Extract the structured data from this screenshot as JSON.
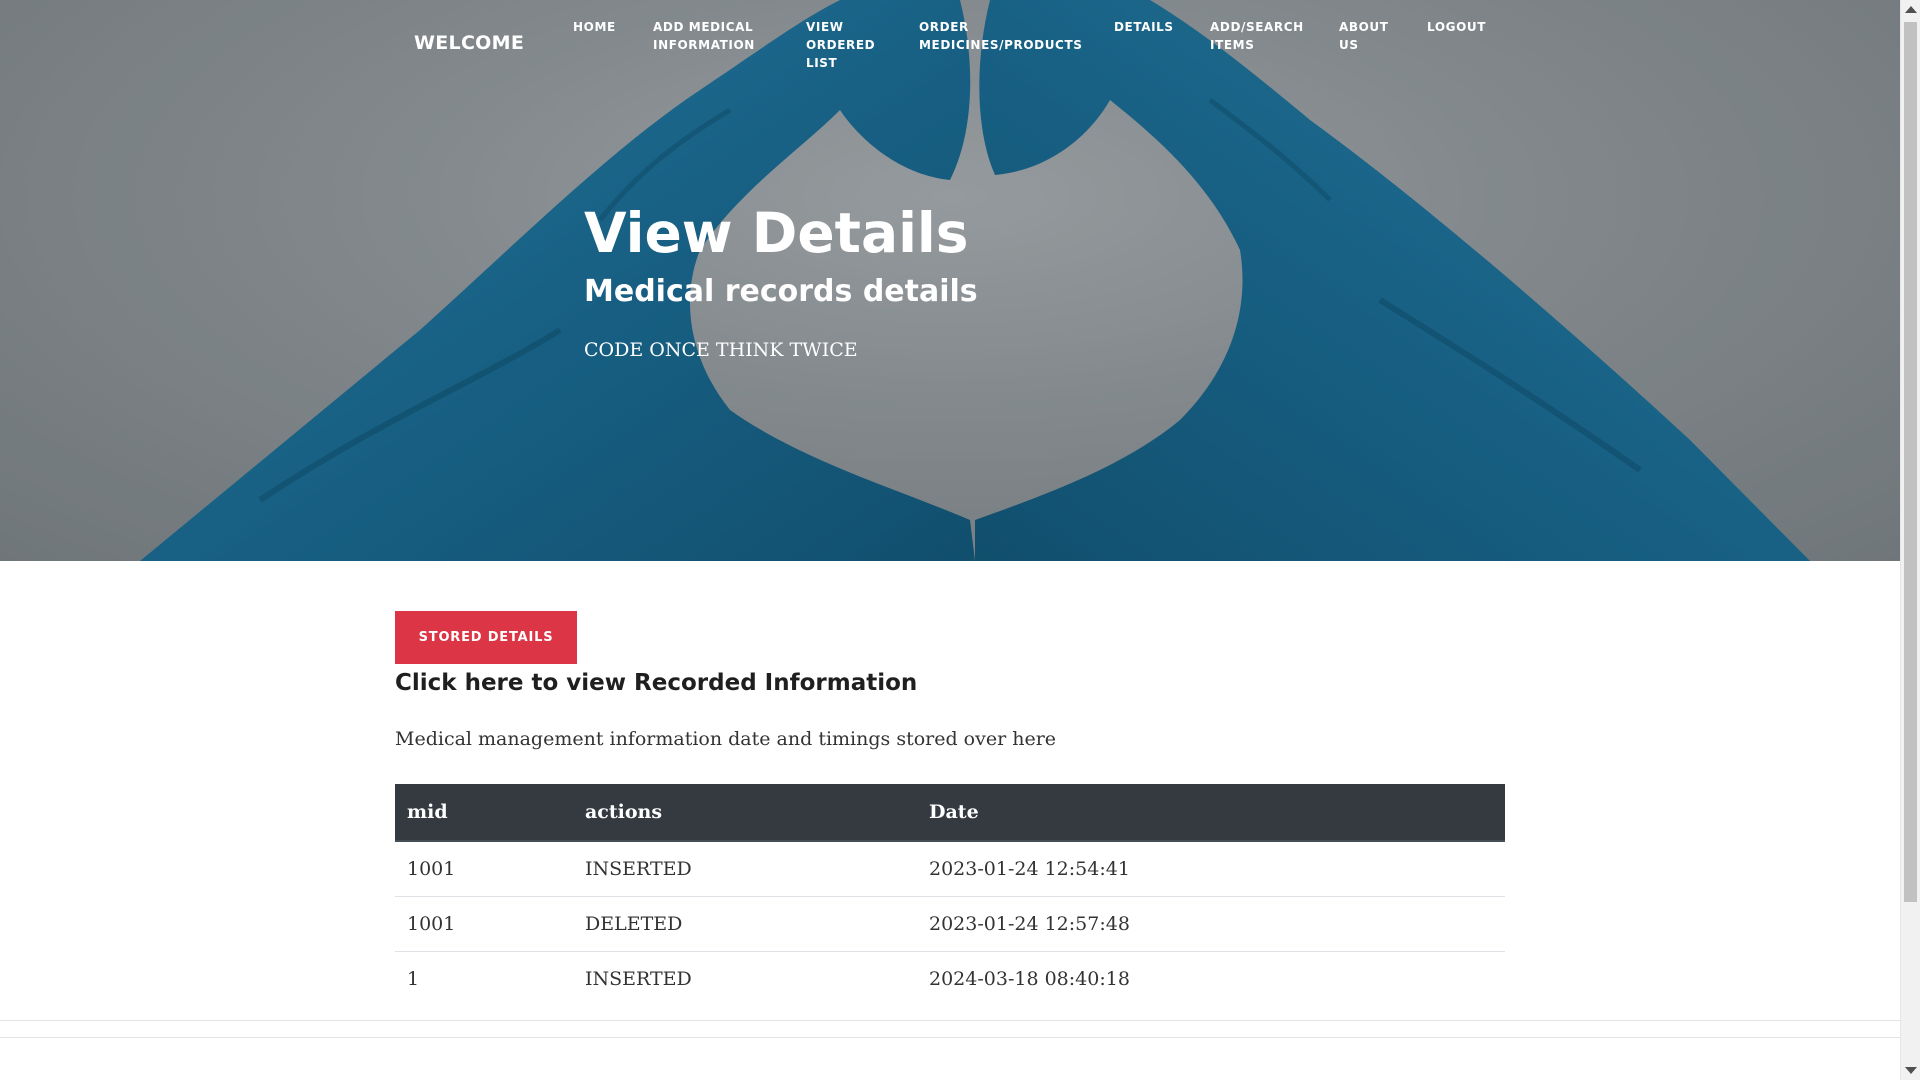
{
  "nav": {
    "brand": "WELCOME",
    "items": [
      {
        "id": "home",
        "label": "HOME"
      },
      {
        "id": "add-medical-information",
        "label": "ADD MEDICAL INFORMATION"
      },
      {
        "id": "view-ordered-list",
        "label": "VIEW ORDERED LIST"
      },
      {
        "id": "order-medicines-products",
        "label": "ORDER MEDICINES/PRODUCTS"
      },
      {
        "id": "details",
        "label": "DETAILS"
      },
      {
        "id": "add-search-items",
        "label": "ADD/SEARCH ITEMS"
      },
      {
        "id": "about-us",
        "label": "ABOUT US"
      },
      {
        "id": "logout",
        "label": "LOGOUT"
      }
    ]
  },
  "hero": {
    "title": "View Details",
    "subtitle": "Medical records details",
    "tagline": "CODE ONCE THINK TWICE",
    "icon": "heart-hands-gloves"
  },
  "content": {
    "button_label": "STORED DETAILS",
    "heading": "Click here to view Recorded Information",
    "description": "Medical management information date and timings stored over here"
  },
  "table": {
    "headers": [
      "mid",
      "actions",
      "Date"
    ],
    "rows": [
      [
        "1001",
        "INSERTED",
        "2023-01-24 12:54:41"
      ],
      [
        "1001",
        "DELETED",
        "2023-01-24 12:57:48"
      ],
      [
        "1",
        "INSERTED",
        "2024-03-18 08:40:18"
      ]
    ]
  },
  "colors": {
    "accent": "#dc3545",
    "table_header": "#343a40",
    "glove": "#1e6f96"
  }
}
